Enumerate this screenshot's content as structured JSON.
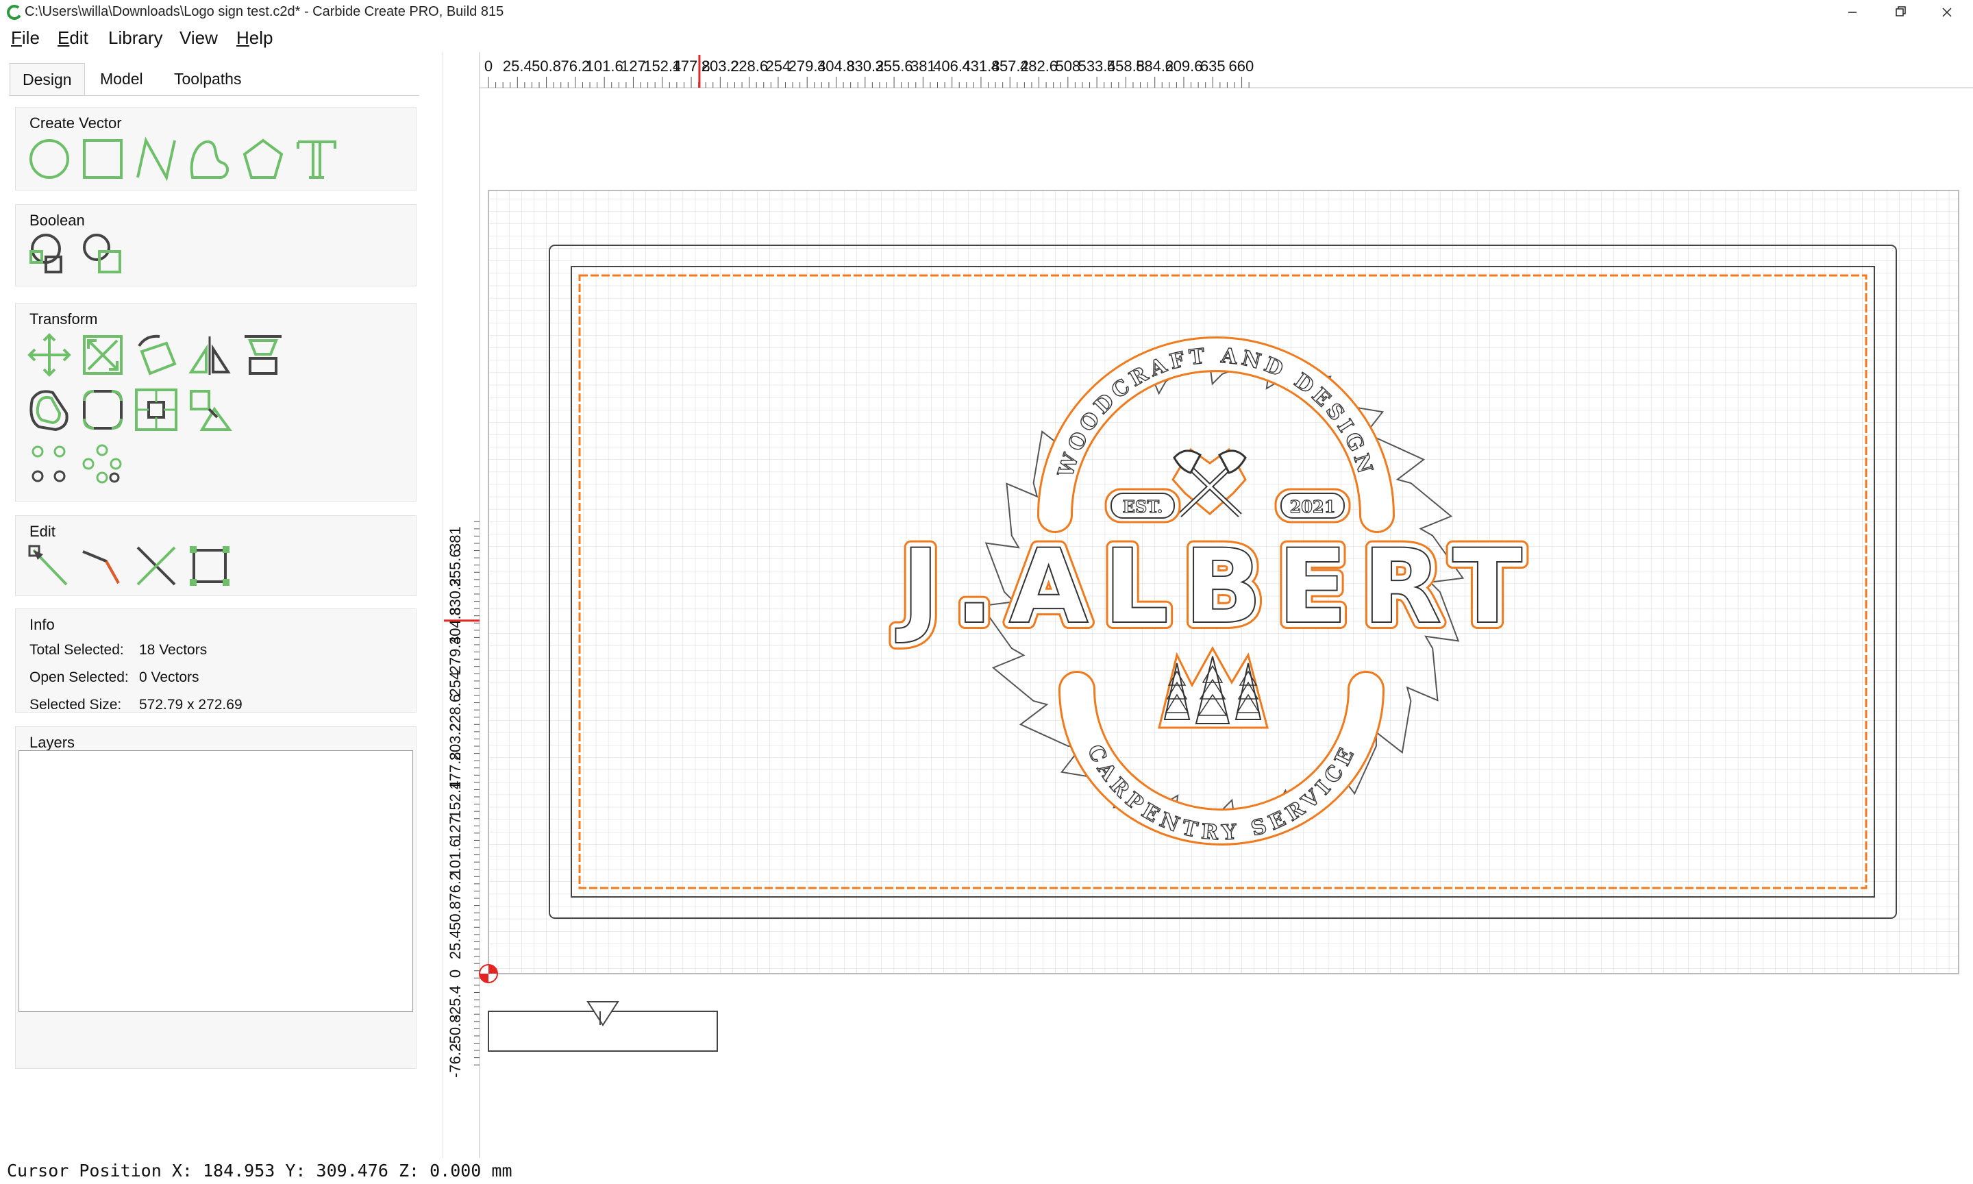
{
  "window": {
    "title": "C:\\Users\\willa\\Downloads\\Logo sign test.c2d* - Carbide Create PRO, Build 815",
    "icon": "carbide-c-icon",
    "controls": [
      "minimize-icon",
      "restore-icon",
      "close-icon"
    ]
  },
  "menu": [
    {
      "label": "File",
      "underline": "F",
      "rest": "ile"
    },
    {
      "label": "Edit",
      "underline": "E",
      "rest": "dit"
    },
    {
      "label": "Library",
      "underline": "",
      "rest": "Library"
    },
    {
      "label": "View",
      "underline": "",
      "rest": "View"
    },
    {
      "label": "Help",
      "underline": "H",
      "rest": "elp"
    }
  ],
  "tabs": [
    "Design",
    "Model",
    "Toolpaths"
  ],
  "active_tab": "Design",
  "groups": {
    "create_vector": {
      "title": "Create Vector",
      "tools": [
        "circle-icon",
        "rectangle-icon",
        "polyline-icon",
        "curve-icon",
        "polygon-icon",
        "text-icon"
      ]
    },
    "boolean": {
      "title": "Boolean",
      "tools": [
        "boolean-union-icon",
        "boolean-subtract-icon"
      ]
    },
    "transform": {
      "title": "Transform",
      "tools": [
        "move-icon",
        "scale-icon",
        "rotate-icon",
        "mirror-icon",
        "align-icon",
        "offset-icon",
        "fillet-icon",
        "center-icon",
        "warp-icon",
        "array-grid-icon",
        "array-circular-icon"
      ]
    },
    "edit": {
      "title": "Edit",
      "tools": [
        "node-edit-icon",
        "trim-icon",
        "cut-icon",
        "bounding-box-icon"
      ]
    },
    "info": {
      "title": "Info",
      "total_selected_label": "Total Selected:",
      "total_selected_value": "18 Vectors",
      "open_selected_label": "Open Selected:",
      "open_selected_value": "0 Vectors",
      "selected_size_label": "Selected Size:",
      "selected_size_value": "572.79 x 272.69"
    },
    "layers": {
      "title": "Layers"
    }
  },
  "ruler_x_labels": [
    "0",
    "25.4",
    "50.8",
    "76.2",
    "101.6",
    "127",
    "152.4",
    "177.8",
    "203.2",
    "228.6",
    "254",
    "279.4",
    "304.8",
    "330.2",
    "355.6",
    "381",
    "406.4",
    "431.8",
    "457.2",
    "482.6",
    "508",
    "533.4",
    "558.8",
    "584.2",
    "609.6",
    "635",
    "660"
  ],
  "ruler_y_labels": [
    "381",
    "355.6",
    "330.2",
    "304.8",
    "279.4",
    "254",
    "228.6",
    "203.2",
    "177.8",
    "152.4",
    "127",
    "101.6",
    "76.2",
    "50.8",
    "25.4",
    "0",
    "-25.4",
    "-50.8",
    "-76.2"
  ],
  "cursor_marker": {
    "x": 184.953,
    "y": 309.476
  },
  "design": {
    "arc_top": "WOODCRAFT AND DESIGN",
    "est": "EST.",
    "year": "2021",
    "name": "J.ALBERT",
    "arc_bottom": "CARPENTRY SERVICE"
  },
  "colors": {
    "toolpath": "#f07a1e",
    "vector": "#3a3a3a",
    "icon": "#6dbf6a",
    "grid": "#d8d8d8",
    "cursor": "#e52424"
  },
  "status": {
    "cursor_position": "Cursor Position X: 184.953 Y: 309.476 Z: 0.000 mm"
  }
}
